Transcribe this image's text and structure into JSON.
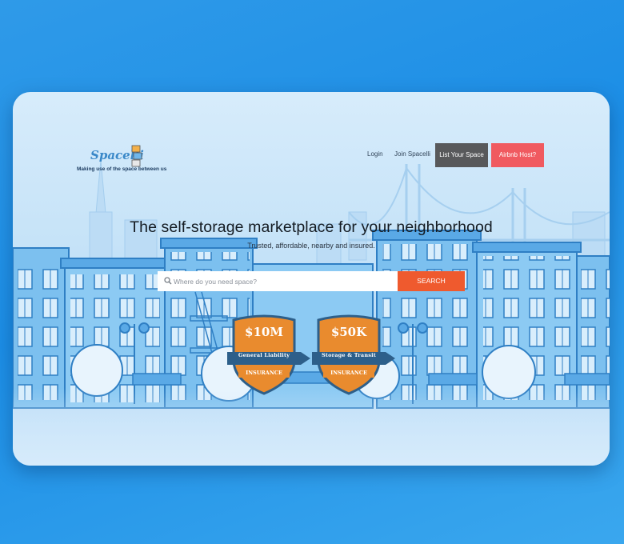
{
  "brand": {
    "name": "Spacelli",
    "tagline": "Making use of the space between us"
  },
  "nav": {
    "login": "Login",
    "join": "Join Spacelli",
    "list_space": "List Your Space",
    "airbnb": "Airbnb Host?"
  },
  "hero": {
    "title": "The self-storage marketplace for your neighborhood",
    "subtitle": "Trusted, affordable, nearby and insured."
  },
  "search": {
    "placeholder": "Where do you need space?",
    "button": "SEARCH"
  },
  "badges": [
    {
      "amount": "$10M",
      "line1": "General Liability",
      "line2": "INSURANCE"
    },
    {
      "amount": "$50K",
      "line1": "Storage & Transit",
      "line2": "INSURANCE"
    }
  ],
  "colors": {
    "outer_background": "#1c8ee6",
    "search_button": "#ef5a2e",
    "list_space_button": "#58595b",
    "airbnb_button": "#f05a60",
    "badge_orange": "#e98b2e",
    "badge_ribbon": "#2d5f8a",
    "illustration_blue": "#4a9fdd"
  }
}
